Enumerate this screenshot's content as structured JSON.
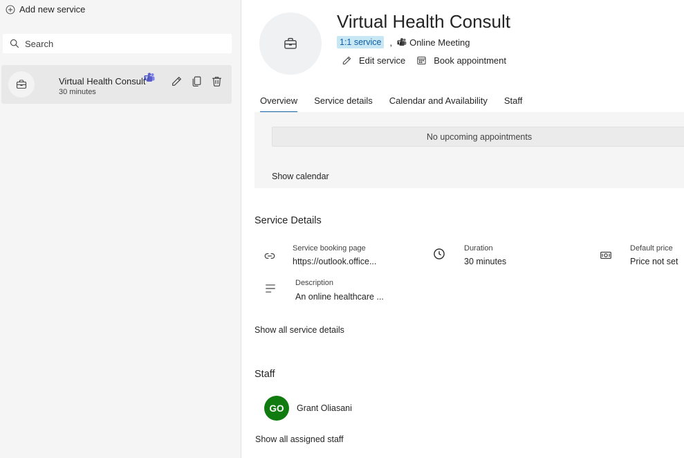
{
  "sidebar": {
    "add_new_label": "Add new service",
    "search_placeholder": "Search",
    "service_item": {
      "name": "Virtual Health Consult",
      "duration": "30 minutes"
    }
  },
  "header": {
    "title": "Virtual Health Consult",
    "badge": "1:1 service",
    "separator": ",",
    "meeting_type": "Online Meeting",
    "edit_label": "Edit service",
    "book_label": "Book appointment"
  },
  "tabs": [
    {
      "label": "Overview",
      "active": true
    },
    {
      "label": "Service details",
      "active": false
    },
    {
      "label": "Calendar and Availability",
      "active": false
    },
    {
      "label": "Staff",
      "active": false
    }
  ],
  "overview": {
    "empty_text": "No upcoming appointments",
    "show_calendar": "Show calendar"
  },
  "service_details": {
    "title": "Service Details",
    "booking_page_label": "Service booking page",
    "booking_page_value": "https://outlook.office...",
    "duration_label": "Duration",
    "duration_value": "30 minutes",
    "price_label": "Default price",
    "price_value": "Price not set",
    "description_label": "Description",
    "description_value": "An online healthcare ...",
    "show_all": "Show all service details"
  },
  "staff": {
    "title": "Staff",
    "members": [
      {
        "initials": "GO",
        "name": "Grant Oliasani",
        "color": "#107c10"
      }
    ],
    "show_all": "Show all assigned staff"
  },
  "colors": {
    "accent": "#115ea3",
    "badge_bg": "#c7e7f4",
    "teams": "#5b5fc7"
  }
}
